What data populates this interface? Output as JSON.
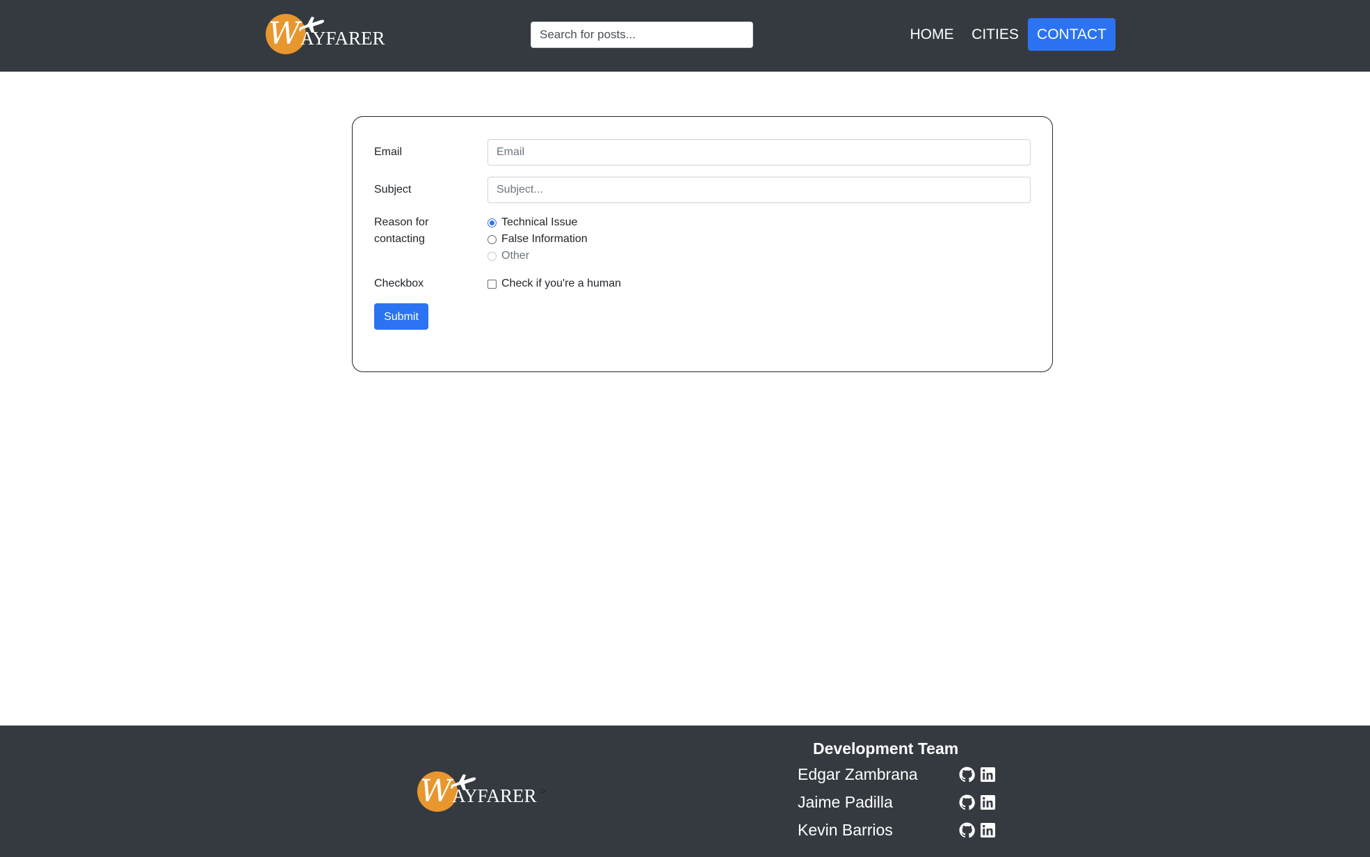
{
  "nav": {
    "logo_w": "W",
    "logo_text": "AYFARER",
    "search_placeholder": "Search for posts...",
    "links": [
      {
        "label": "HOME"
      },
      {
        "label": "CITIES"
      },
      {
        "label": "CONTACT",
        "active": true
      }
    ]
  },
  "form": {
    "email": {
      "label": "Email",
      "placeholder": "Email"
    },
    "subject": {
      "label": "Subject",
      "placeholder": "Subject..."
    },
    "reason": {
      "label_line1": "Reason for",
      "label_line2": "contacting",
      "options": [
        {
          "label": "Technical Issue",
          "checked": true
        },
        {
          "label": "False Information",
          "checked": false
        },
        {
          "label": "Other",
          "checked": false,
          "disabled": true
        }
      ]
    },
    "checkbox": {
      "label": "Checkbox",
      "option": "Check if you're a human",
      "checked": false
    },
    "submit_label": "Submit"
  },
  "footer": {
    "logo_w": "W",
    "logo_text": "AYFARER",
    "gt": ">",
    "team_title": "Development Team",
    "members": [
      {
        "name": "Edgar Zambrana"
      },
      {
        "name": "Jaime Padilla"
      },
      {
        "name": "Kevin Barrios"
      }
    ]
  },
  "colors": {
    "navbar_bg": "#343a40",
    "accent": "#2b73f2",
    "logo_orange": "#e8962e"
  },
  "icons": [
    "github-icon",
    "linkedin-icon",
    "airplane-icon"
  ]
}
